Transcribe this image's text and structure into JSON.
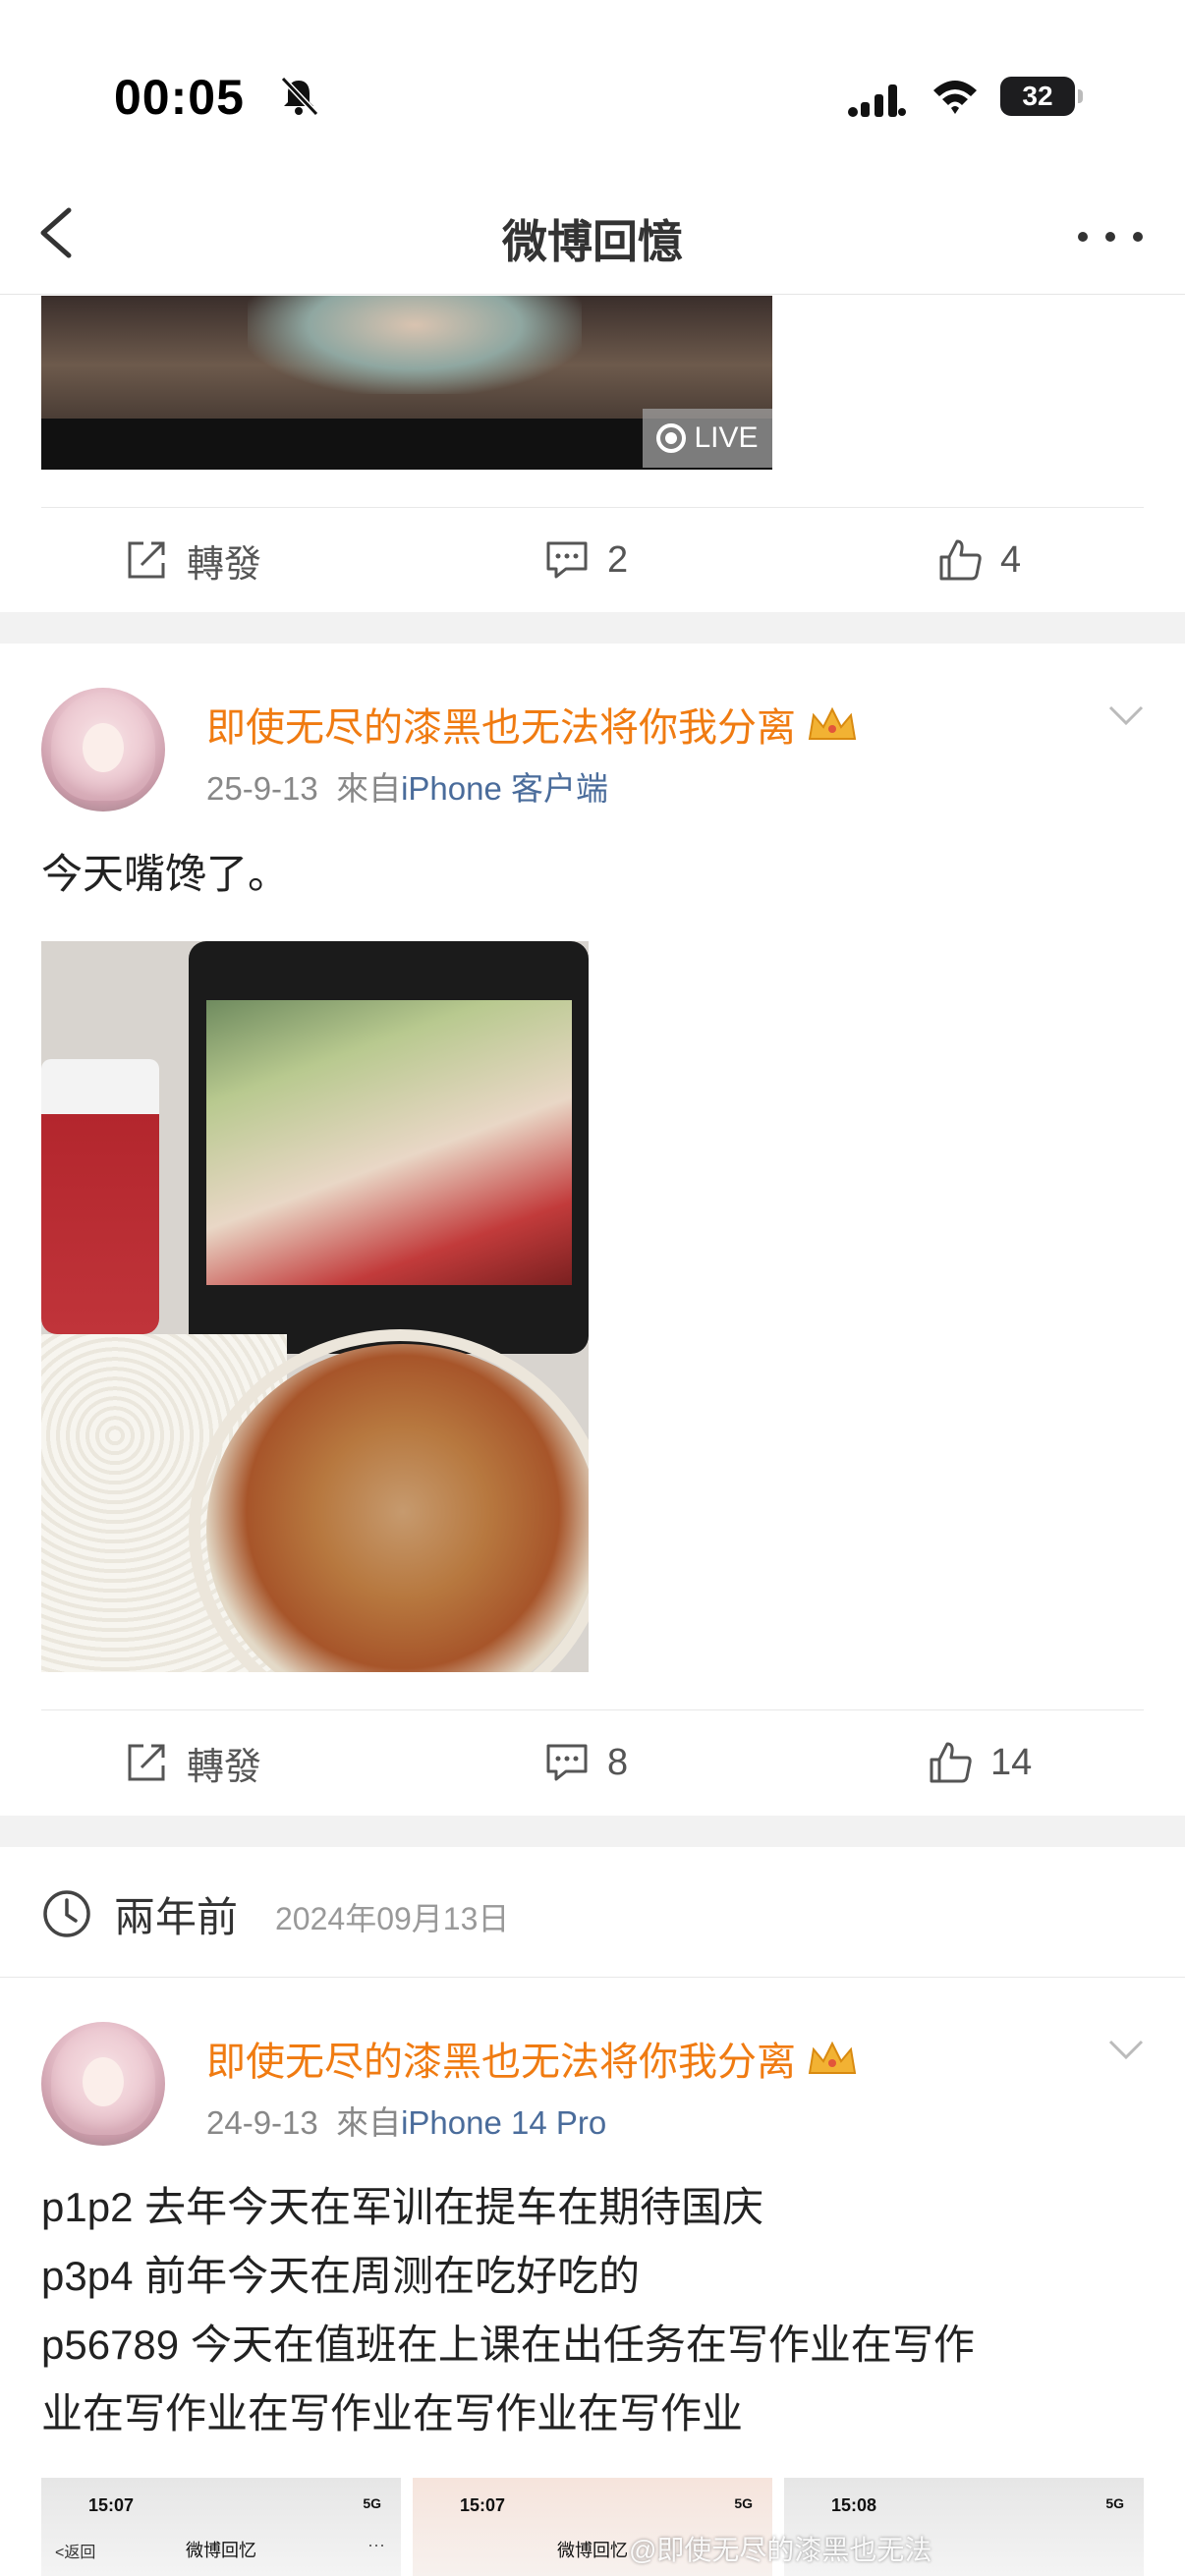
{
  "status_bar": {
    "time": "00:05",
    "battery": "32"
  },
  "nav": {
    "title": "微博回憶"
  },
  "post1": {
    "live_label": "LIVE",
    "actions": {
      "repost": "轉發",
      "comments": "2",
      "likes": "4"
    }
  },
  "post2": {
    "username": "即使无尽的漆黑也无法将你我分离",
    "date": "25-9-13",
    "source_prefix": "來自",
    "source": "iPhone 客户端",
    "text": "今天嘴馋了。",
    "actions": {
      "repost": "轉發",
      "comments": "8",
      "likes": "14"
    }
  },
  "memory": {
    "label": "兩年前",
    "date": "2024年09月13日"
  },
  "post3": {
    "username": "即使无尽的漆黑也无法将你我分离",
    "date": "24-9-13",
    "source_prefix": "來自",
    "source": "iPhone 14 Pro",
    "lines": [
      "p1p2 去年今天在军训在提车在期待国庆",
      "p3p4 前年今天在周测在吃好吃的",
      "p56789 今天在值班在上课在出任务在写作业在写作",
      "业在写作业在写作业在写作业在写作业"
    ],
    "thumbs": [
      {
        "time": "15:07",
        "back": "<返回",
        "title": "微博回忆",
        "status": "5G"
      },
      {
        "time": "15:07",
        "title": "微博回忆",
        "status": "5G"
      },
      {
        "time": "15:08",
        "status": "5G"
      }
    ],
    "watermark": "@即使无尽的漆黑也无法"
  },
  "colors": {
    "username": "#f07b11",
    "source": "#4a6c9b",
    "separator": "#f2f2f2"
  }
}
